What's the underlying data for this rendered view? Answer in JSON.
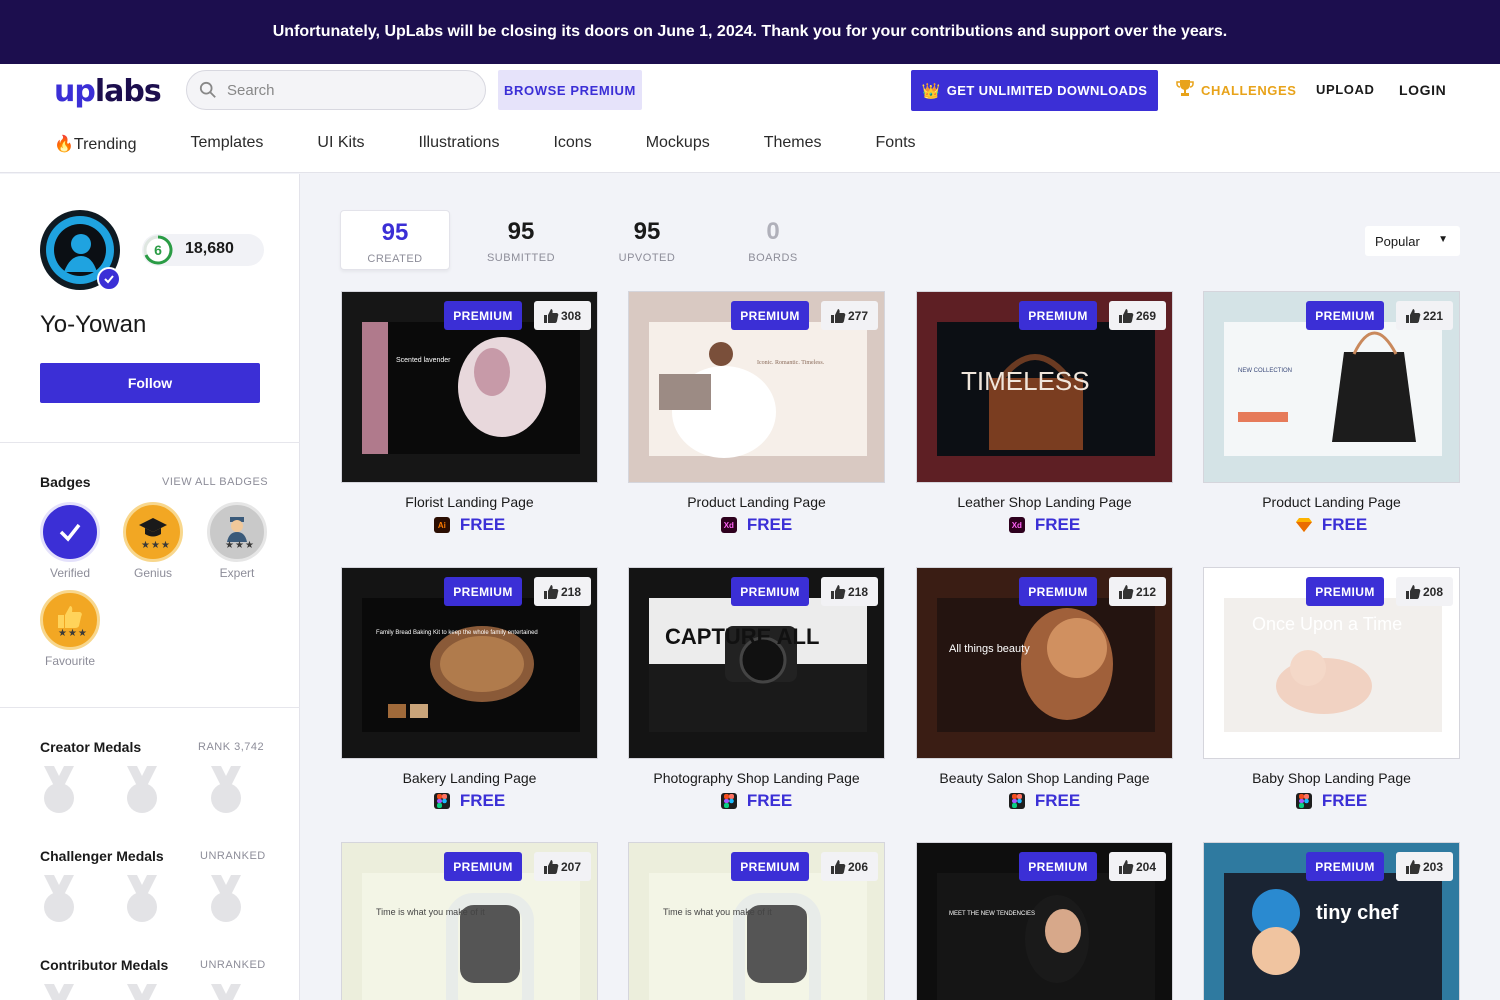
{
  "banner": {
    "text": "Unfortunately, UpLabs will be closing its doors on June 1, 2024. Thank you for your contributions and support over the years."
  },
  "header": {
    "logo_up": "up",
    "logo_labs": "labs",
    "search_placeholder": "Search",
    "browse_premium": "BROWSE PREMIUM",
    "unlimited_downloads": "GET UNLIMITED DOWNLOADS",
    "challenges": "CHALLENGES",
    "upload": "UPLOAD",
    "login": "LOGIN",
    "accent_color": "#3b2fd6",
    "challenges_color": "#e8a31a"
  },
  "categories": [
    "Trending",
    "Templates",
    "UI Kits",
    "Illustrations",
    "Icons",
    "Mockups",
    "Themes",
    "Fonts"
  ],
  "profile": {
    "level": "6",
    "points": "18,680",
    "name": "Yo-Yowan",
    "follow": "Follow",
    "badges_title": "Badges",
    "view_all_badges": "VIEW ALL BADGES",
    "badges": [
      {
        "label": "Verified",
        "icon": "checkmark-icon"
      },
      {
        "label": "Genius",
        "icon": "graduation-cap-icon"
      },
      {
        "label": "Expert",
        "icon": "expert-person-icon"
      },
      {
        "label": "Favourite",
        "icon": "thumbs-up-icon"
      }
    ],
    "creator_medals": "Creator Medals",
    "creator_rank": "RANK 3,742",
    "challenger_medals": "Challenger Medals",
    "challenger_rank": "UNRANKED",
    "contributor_medals": "Contributor Medals",
    "contributor_rank": "UNRANKED"
  },
  "stats": [
    {
      "num": "95",
      "cap": "CREATED"
    },
    {
      "num": "95",
      "cap": "SUBMITTED"
    },
    {
      "num": "95",
      "cap": "UPVOTED"
    },
    {
      "num": "0",
      "cap": "BOARDS"
    }
  ],
  "sort": {
    "value": "Popular"
  },
  "cards": [
    {
      "title": "Florist Landing Page",
      "likes": "308",
      "premium": "PREMIUM",
      "free": "FREE",
      "app": "Ai",
      "thumb_text": "Scented lavender"
    },
    {
      "title": "Product Landing Page",
      "likes": "277",
      "premium": "PREMIUM",
      "free": "FREE",
      "app": "Xd",
      "thumb_text": "Iconic. Romantic. Timeless."
    },
    {
      "title": "Leather Shop Landing Page",
      "likes": "269",
      "premium": "PREMIUM",
      "free": "FREE",
      "app": "Xd",
      "thumb_text": "TIMELESS"
    },
    {
      "title": "Product Landing Page",
      "likes": "221",
      "premium": "PREMIUM",
      "free": "FREE",
      "app": "Sketch",
      "thumb_text": "NEW COLLECTION"
    },
    {
      "title": "Bakery Landing Page",
      "likes": "218",
      "premium": "PREMIUM",
      "free": "FREE",
      "app": "Figma",
      "thumb_text": "Family Bread Baking Kit to keep the whole family entertained"
    },
    {
      "title": "Photography Shop Landing Page",
      "likes": "218",
      "premium": "PREMIUM",
      "free": "FREE",
      "app": "Figma",
      "thumb_text": "CAPTURE ALL"
    },
    {
      "title": "Beauty Salon Shop Landing Page",
      "likes": "212",
      "premium": "PREMIUM",
      "free": "FREE",
      "app": "Figma",
      "thumb_text": "All things beauty"
    },
    {
      "title": "Baby Shop Landing Page",
      "likes": "208",
      "premium": "PREMIUM",
      "free": "FREE",
      "app": "Figma",
      "thumb_text": "Once Upon a Time"
    },
    {
      "title": "",
      "likes": "207",
      "premium": "PREMIUM",
      "free": "",
      "app": "",
      "thumb_text": "Time is what you make of it"
    },
    {
      "title": "",
      "likes": "206",
      "premium": "PREMIUM",
      "free": "",
      "app": "",
      "thumb_text": "Time is what you make of it"
    },
    {
      "title": "",
      "likes": "204",
      "premium": "PREMIUM",
      "free": "",
      "app": "",
      "thumb_text": "MEET THE NEW TENDENCIES"
    },
    {
      "title": "",
      "likes": "203",
      "premium": "PREMIUM",
      "free": "",
      "app": "",
      "thumb_text": "tiny chef"
    }
  ]
}
